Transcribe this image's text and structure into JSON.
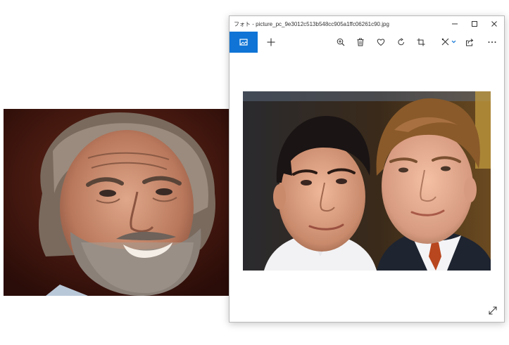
{
  "window": {
    "title": "フォト - picture_pc_9e3012c513b548cc905a1ffc06261c90.jpg"
  },
  "toolbar": {
    "items": [
      {
        "name": "home-collection-icon"
      },
      {
        "name": "add-icon"
      },
      {
        "name": "zoom-in-icon"
      },
      {
        "name": "delete-icon"
      },
      {
        "name": "favorite-icon"
      },
      {
        "name": "rotate-icon"
      },
      {
        "name": "crop-icon"
      },
      {
        "name": "edit-icon"
      },
      {
        "name": "share-icon"
      },
      {
        "name": "more-icon"
      }
    ]
  },
  "colors": {
    "accent": "#0f74d6",
    "window_border": "#b9b9b9",
    "icon": "#333333"
  },
  "icons": {
    "minimize": "minimize-icon",
    "maximize": "maximize-icon",
    "close": "close-icon",
    "fullscreen": "expand-icon"
  }
}
